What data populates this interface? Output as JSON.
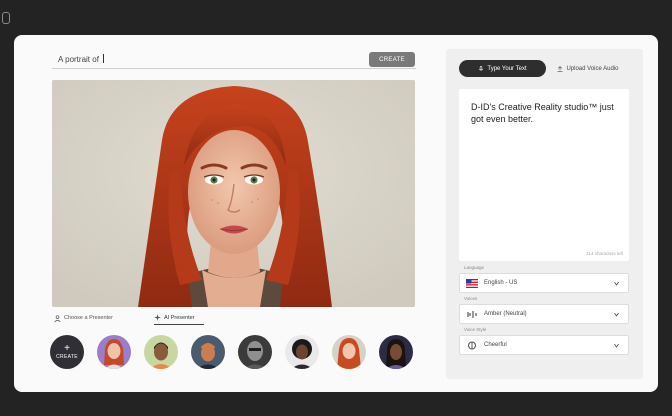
{
  "prompt": {
    "prefix": "A portrait of"
  },
  "create_button": {
    "label": "CREATE"
  },
  "presenter_tabs": [
    {
      "label": "Choose a Presenter"
    },
    {
      "label": "AI Presenter"
    }
  ],
  "avatar_row": {
    "create_label": "CREATE"
  },
  "right_panel": {
    "tabs": [
      {
        "label": "Type Your Text"
      },
      {
        "label": "Upload Voice Audio"
      }
    ],
    "text": "D-ID's Creative Reality studio™ just got even better.",
    "char_count": "314 characters left",
    "language": {
      "label": "Language",
      "value": "English - US"
    },
    "voice": {
      "label": "Voices",
      "value": "Amber (Neutral)"
    },
    "voice_style": {
      "label": "Voice Style",
      "value": "Cheerful"
    }
  },
  "colors": {
    "background": "#232323",
    "card": "#fafafa",
    "create_button": "#7a7a7a",
    "active_tab": "#2e2e2e"
  },
  "icons": [
    "user-icon",
    "sparkle-icon",
    "microphone-icon",
    "upload-icon",
    "us-flag-icon",
    "voice-icon",
    "style-icon",
    "chevron-down-icon"
  ]
}
